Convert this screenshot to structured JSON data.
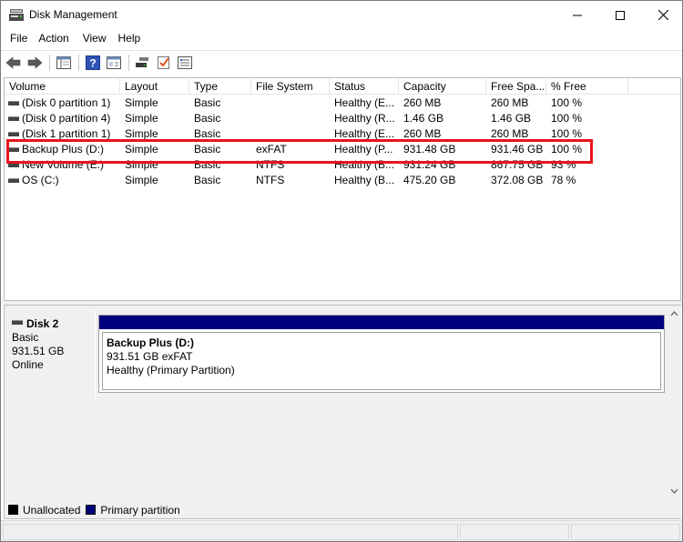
{
  "window": {
    "title": "Disk Management",
    "icon": "disk-management-icon"
  },
  "menu": [
    "File",
    "Action",
    "View",
    "Help"
  ],
  "toolbar": {
    "buttons": [
      "back-icon",
      "forward-icon",
      "show-hide-console-tree-icon",
      "help-icon",
      "properties-icon",
      "connect-icon",
      "checklist-icon",
      "settings-panel-icon"
    ]
  },
  "volumes": {
    "columns": [
      "Volume",
      "Layout",
      "Type",
      "File System",
      "Status",
      "Capacity",
      "Free Spa...",
      "% Free"
    ],
    "rows": [
      {
        "volume": "(Disk 0 partition 1)",
        "layout": "Simple",
        "type": "Basic",
        "fs": "",
        "status": "Healthy (E...",
        "capacity": "260 MB",
        "free": "260 MB",
        "pct": "100 %"
      },
      {
        "volume": "(Disk 0 partition 4)",
        "layout": "Simple",
        "type": "Basic",
        "fs": "",
        "status": "Healthy (R...",
        "capacity": "1.46 GB",
        "free": "1.46 GB",
        "pct": "100 %"
      },
      {
        "volume": "(Disk 1 partition 1)",
        "layout": "Simple",
        "type": "Basic",
        "fs": "",
        "status": "Healthy (E...",
        "capacity": "260 MB",
        "free": "260 MB",
        "pct": "100 %"
      },
      {
        "volume": "Backup Plus (D:)",
        "layout": "Simple",
        "type": "Basic",
        "fs": "exFAT",
        "status": "Healthy (P...",
        "capacity": "931.48 GB",
        "free": "931.46 GB",
        "pct": "100 %"
      },
      {
        "volume": "New Volume (E:)",
        "layout": "Simple",
        "type": "Basic",
        "fs": "NTFS",
        "status": "Healthy (B...",
        "capacity": "931.24 GB",
        "free": "867.75 GB",
        "pct": "93 %"
      },
      {
        "volume": "OS (C:)",
        "layout": "Simple",
        "type": "Basic",
        "fs": "NTFS",
        "status": "Healthy (B...",
        "capacity": "475.20 GB",
        "free": "372.08 GB",
        "pct": "78 %"
      }
    ],
    "highlight_color": "#e8141e"
  },
  "disk": {
    "name": "Disk 2",
    "type": "Basic",
    "size": "931.51 GB",
    "state": "Online",
    "partition": {
      "title": "Backup Plus  (D:)",
      "size_fs": "931.51 GB exFAT",
      "status": "Healthy (Primary Partition)",
      "color": "#00007f"
    }
  },
  "legend": [
    {
      "label": "Unallocated",
      "color": "#000000"
    },
    {
      "label": "Primary partition",
      "color": "#00007f"
    }
  ]
}
